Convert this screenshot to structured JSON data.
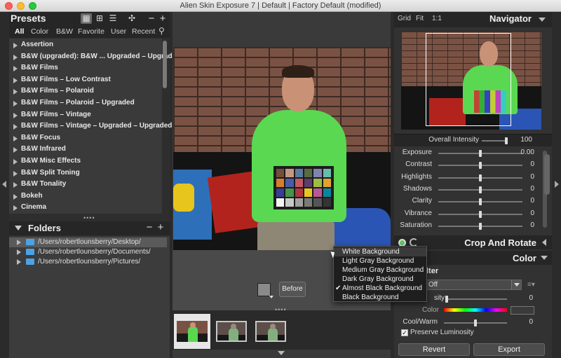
{
  "window": {
    "title": "Alien Skin Exposure 7 | Default | Factory Default (modified)"
  },
  "presets": {
    "title": "Presets",
    "tabs": [
      "All",
      "Color",
      "B&W",
      "Favorite",
      "User",
      "Recent"
    ],
    "active_tab": "All",
    "items": [
      "Assertion",
      "B&W (upgraded): B&W ... Upgraded – Upgraded",
      "B&W Films",
      "B&W Films – Low Contrast",
      "B&W Films – Polaroid",
      "B&W Films – Polaroid – Upgraded",
      "B&W Films – Vintage",
      "B&W Films – Vintage – Upgraded – Upgraded",
      "B&W Focus",
      "B&W Infrared",
      "B&W Misc Effects",
      "B&W Split Toning",
      "B&W Tonality",
      "Bokeh",
      "Cinema"
    ]
  },
  "folders": {
    "title": "Folders",
    "items": [
      "/Users/robertlounsberry/Desktop/",
      "/Users/robertlounsberry/Documents/",
      "/Users/robertlounsberry/Pictures/"
    ]
  },
  "viewer": {
    "before_label": "Before",
    "background_menu": [
      {
        "label": "White Background",
        "checked": false
      },
      {
        "label": "Light Gray Background",
        "checked": false
      },
      {
        "label": "Medium Gray Background",
        "checked": false
      },
      {
        "label": "Dark Gray Background",
        "checked": false
      },
      {
        "label": "Almost Black Background",
        "checked": true
      },
      {
        "label": "Black Background",
        "checked": false
      }
    ],
    "checkmark": "✔"
  },
  "navigator": {
    "title": "Navigator",
    "options": [
      "Grid",
      "Fit",
      "1:1"
    ]
  },
  "adjustments": {
    "overall": {
      "label": "Overall Intensity",
      "value": "100",
      "level": 1.0
    },
    "sliders": [
      {
        "label": "Exposure",
        "value": "0.00",
        "level": 0.5
      },
      {
        "label": "Contrast",
        "value": "0",
        "level": 0.5
      },
      {
        "label": "Highlights",
        "value": "0",
        "level": 0.5
      },
      {
        "label": "Shadows",
        "value": "0",
        "level": 0.5
      },
      {
        "label": "Clarity",
        "value": "0",
        "level": 0.5
      },
      {
        "label": "Vibrance",
        "value": "0",
        "level": 0.5
      },
      {
        "label": "Saturation",
        "value": "0",
        "level": 0.5
      }
    ]
  },
  "crop_panel": {
    "title": "Crop And Rotate"
  },
  "color_panel": {
    "title": "Color",
    "filter_label": "lter",
    "filter_value": "Off",
    "intensity": {
      "label": "sity",
      "value": "0",
      "level": 0.0
    },
    "color_label": "Color",
    "cool_warm": {
      "label": "Cool/Warm",
      "value": "0",
      "level": 0.5
    },
    "preserve_label": "Preserve Luminosity",
    "preserve_checked": true
  },
  "buttons": {
    "revert": "Revert",
    "export": "Export"
  },
  "colors": {
    "accent_green": "#5ec85e",
    "shirt_green": "#5ad852",
    "folder_blue": "#4aa3e8"
  }
}
